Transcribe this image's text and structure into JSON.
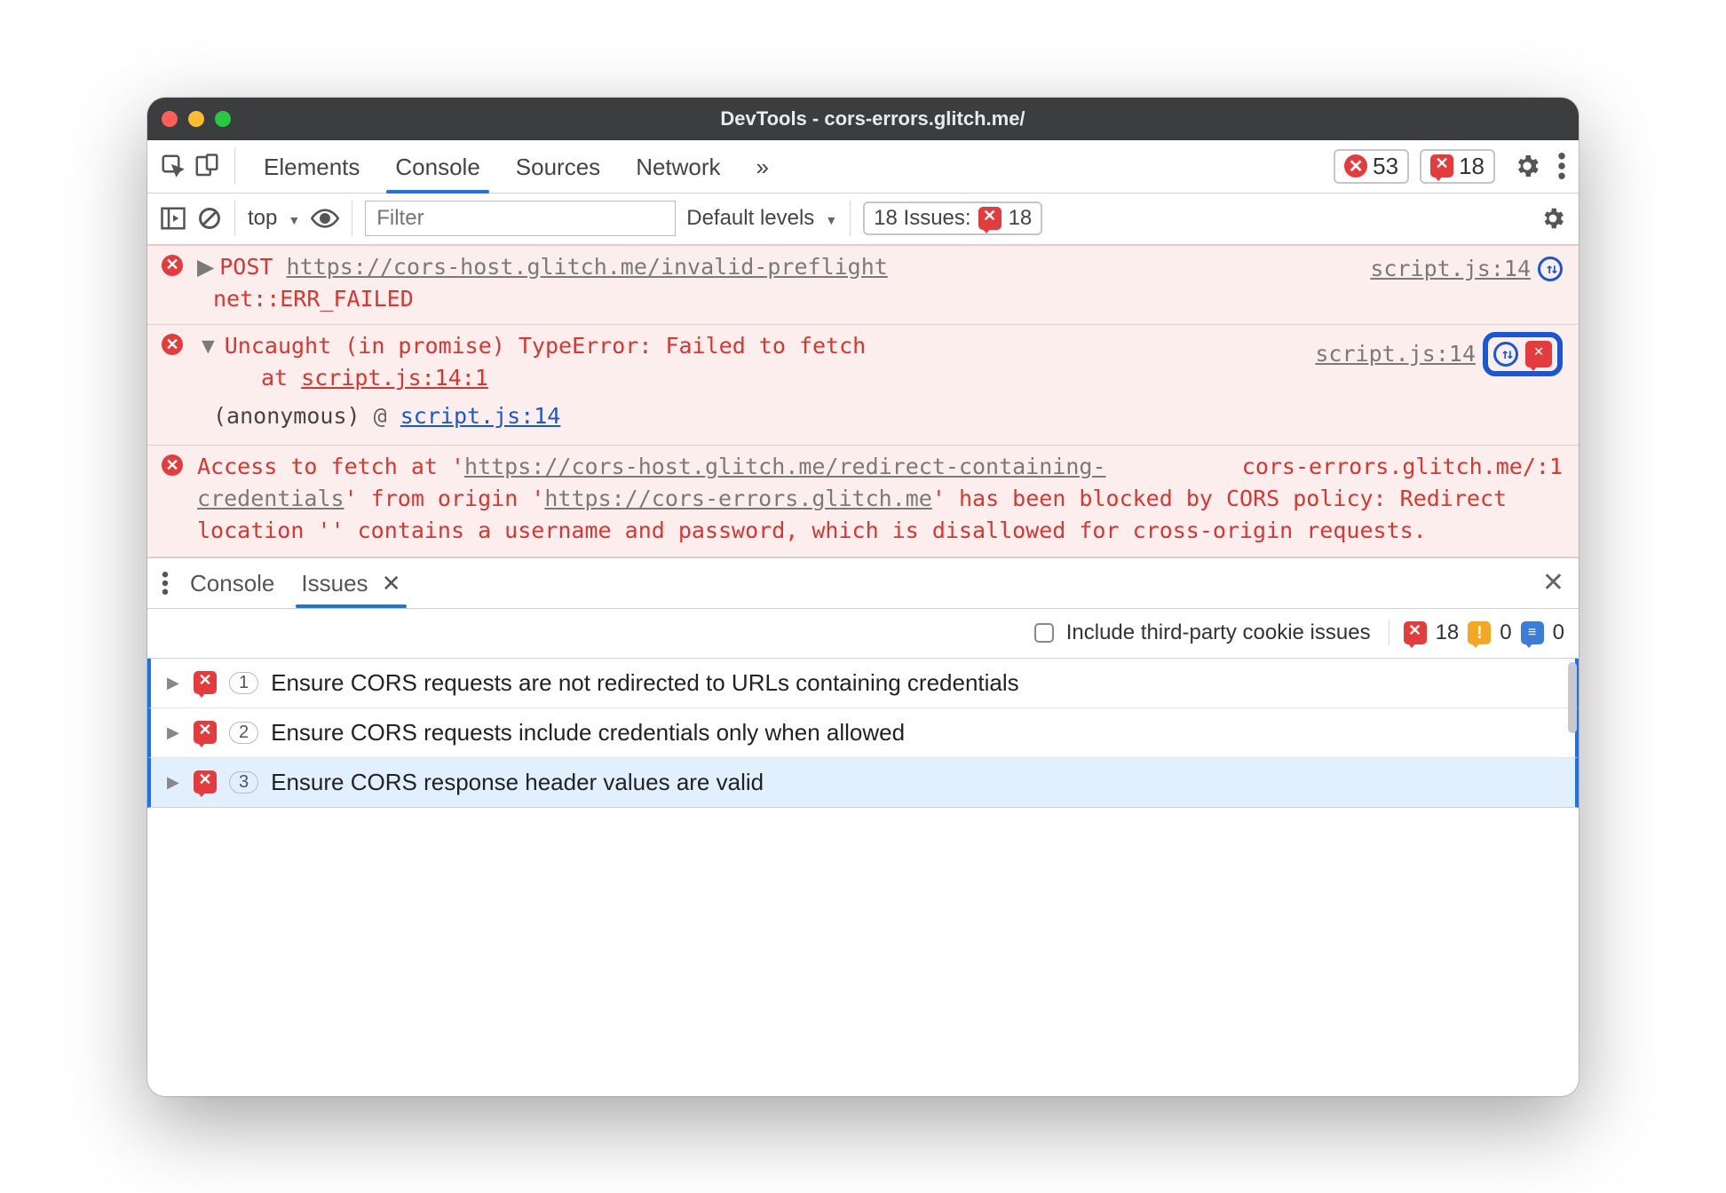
{
  "window": {
    "title": "DevTools - cors-errors.glitch.me/"
  },
  "tabs": {
    "items": [
      "Elements",
      "Console",
      "Sources",
      "Network"
    ],
    "more": "»",
    "active": "Console",
    "errors_count": "53",
    "issues_count": "18"
  },
  "controls": {
    "context": "top",
    "filter_placeholder": "Filter",
    "levels": "Default levels",
    "issues_header": "18 Issues:",
    "issues_badge_count": "18"
  },
  "messages": [
    {
      "kind": "network-error",
      "disclosure": "▶",
      "method": "POST",
      "url": "https://cors-host.glitch.me/invalid-preflight",
      "status_line": "net::ERR_FAILED",
      "source": "script.js:14"
    },
    {
      "kind": "js-error",
      "disclosure": "▼",
      "headline": "Uncaught (in promise) TypeError: Failed to fetch",
      "stack_at": "at ",
      "stack_link": "script.js:14:1",
      "anon_label": "(anonymous)",
      "anon_sep": " @ ",
      "anon_link": "script.js:14",
      "source": "script.js:14"
    },
    {
      "kind": "cors-error",
      "text_pre": "Access to fetch at '",
      "url1": "https://cors-host.glitch.me/redirect-containing-credentials",
      "text_mid1": "' from origin '",
      "url2": "https://cors-errors.glitch.me",
      "text_mid2": "' has been blocked by CORS policy: Redirect location '' contains a username and password, which is disallowed for cross-origin requests.",
      "source": "cors-errors.glitch.me/:1"
    }
  ],
  "drawer": {
    "tabs": {
      "console": "Console",
      "issues": "Issues"
    },
    "include_label": "Include third-party cookie issues",
    "counts": {
      "errors": "18",
      "warnings": "0",
      "info": "0"
    },
    "issues": [
      {
        "count": "1",
        "title": "Ensure CORS requests are not redirected to URLs containing credentials"
      },
      {
        "count": "2",
        "title": "Ensure CORS requests include credentials only when allowed"
      },
      {
        "count": "3",
        "title": "Ensure CORS response header values are valid"
      }
    ]
  }
}
